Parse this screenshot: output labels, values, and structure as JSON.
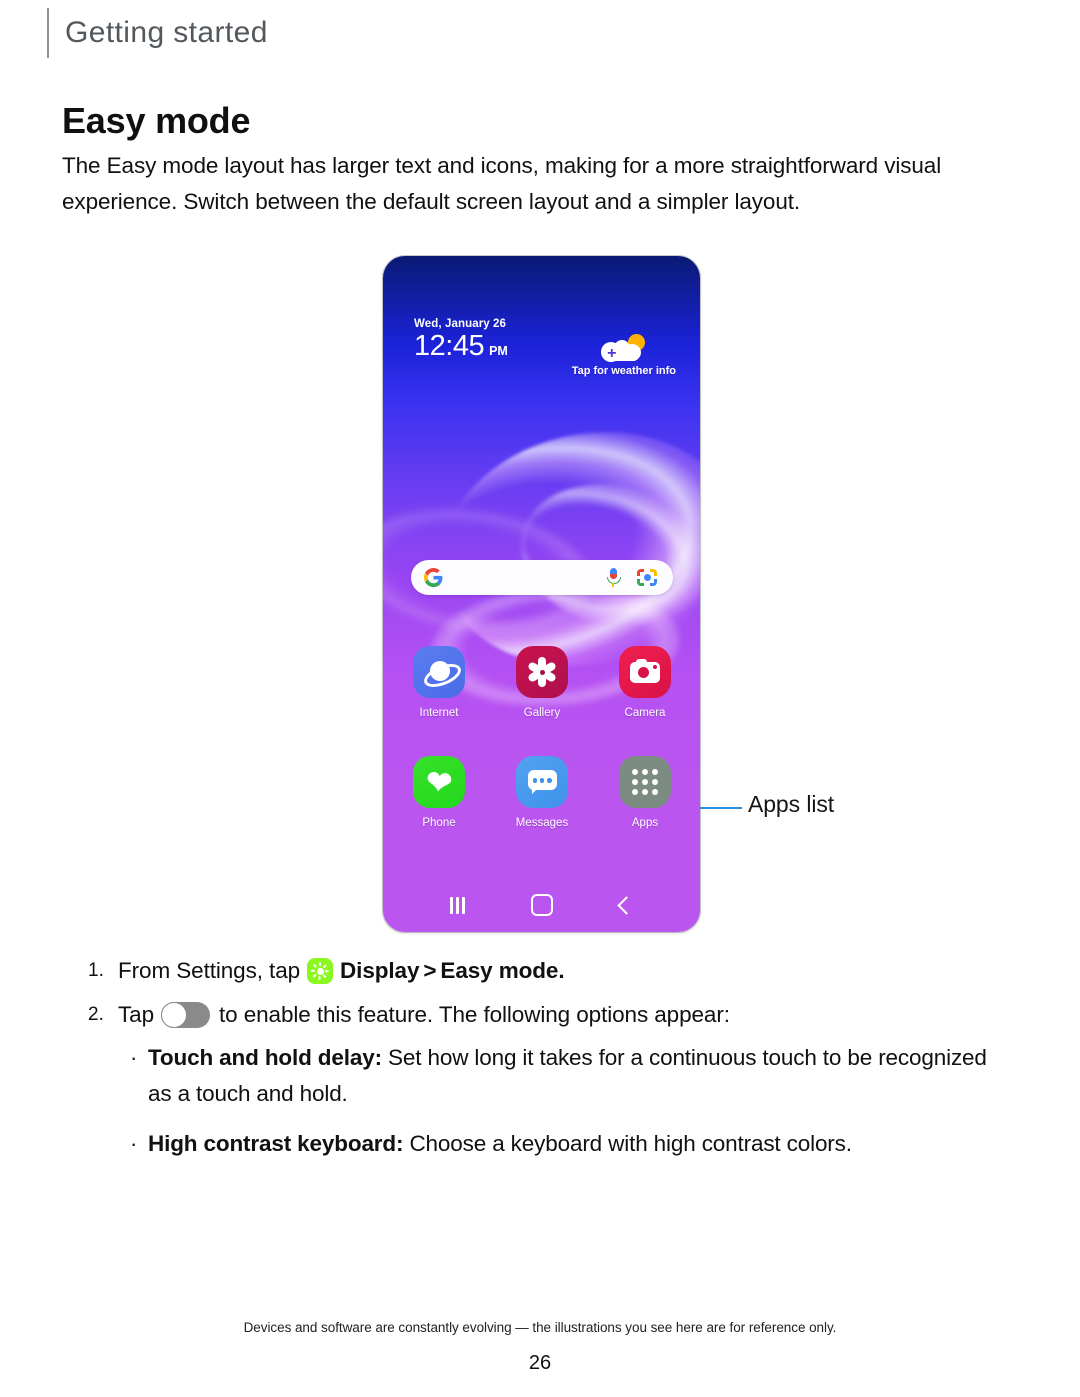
{
  "header": {
    "section_title": "Getting started"
  },
  "page": {
    "heading": "Easy mode",
    "intro": "The Easy mode layout has larger text and icons, making for a more straightforward visual experience. Switch between the default screen layout and a simpler layout."
  },
  "phone": {
    "status": {
      "date": "Wed, January 26",
      "time": "12:45",
      "meridiem": "PM"
    },
    "weather": {
      "caption": "Tap for weather info"
    },
    "search": {
      "placeholder": ""
    },
    "apps_row_1": [
      {
        "label": "Internet"
      },
      {
        "label": "Gallery"
      },
      {
        "label": "Camera"
      }
    ],
    "apps_row_2": [
      {
        "label": "Phone"
      },
      {
        "label": "Messages"
      },
      {
        "label": "Apps"
      }
    ]
  },
  "callout": {
    "label": "Apps list",
    "color": "#2b8fe0"
  },
  "steps": [
    {
      "num": "1.",
      "lead": "From Settings, tap",
      "chip_icon": "brightness-sun-icon",
      "chip_color": "#8bf720",
      "target": "Display",
      "separator": ">",
      "destination": "Easy mode",
      "end": "."
    },
    {
      "num": "2.",
      "lead": "Tap",
      "toggle_state": "off",
      "tail": "to enable this feature. The following options appear:"
    }
  ],
  "bullets": [
    {
      "marker": "·",
      "term": "Touch and hold delay",
      "colon": ":",
      "text": " Set how long it takes for a continuous touch to be recognized as a touch and hold."
    },
    {
      "marker": "·",
      "term": "High contrast keyboard",
      "colon": ":",
      "text": " Choose a keyboard with high contrast colors."
    }
  ],
  "footer": {
    "note": "Devices and software are constantly evolving — the illustrations you see here are for reference only.",
    "page_number": "26"
  }
}
